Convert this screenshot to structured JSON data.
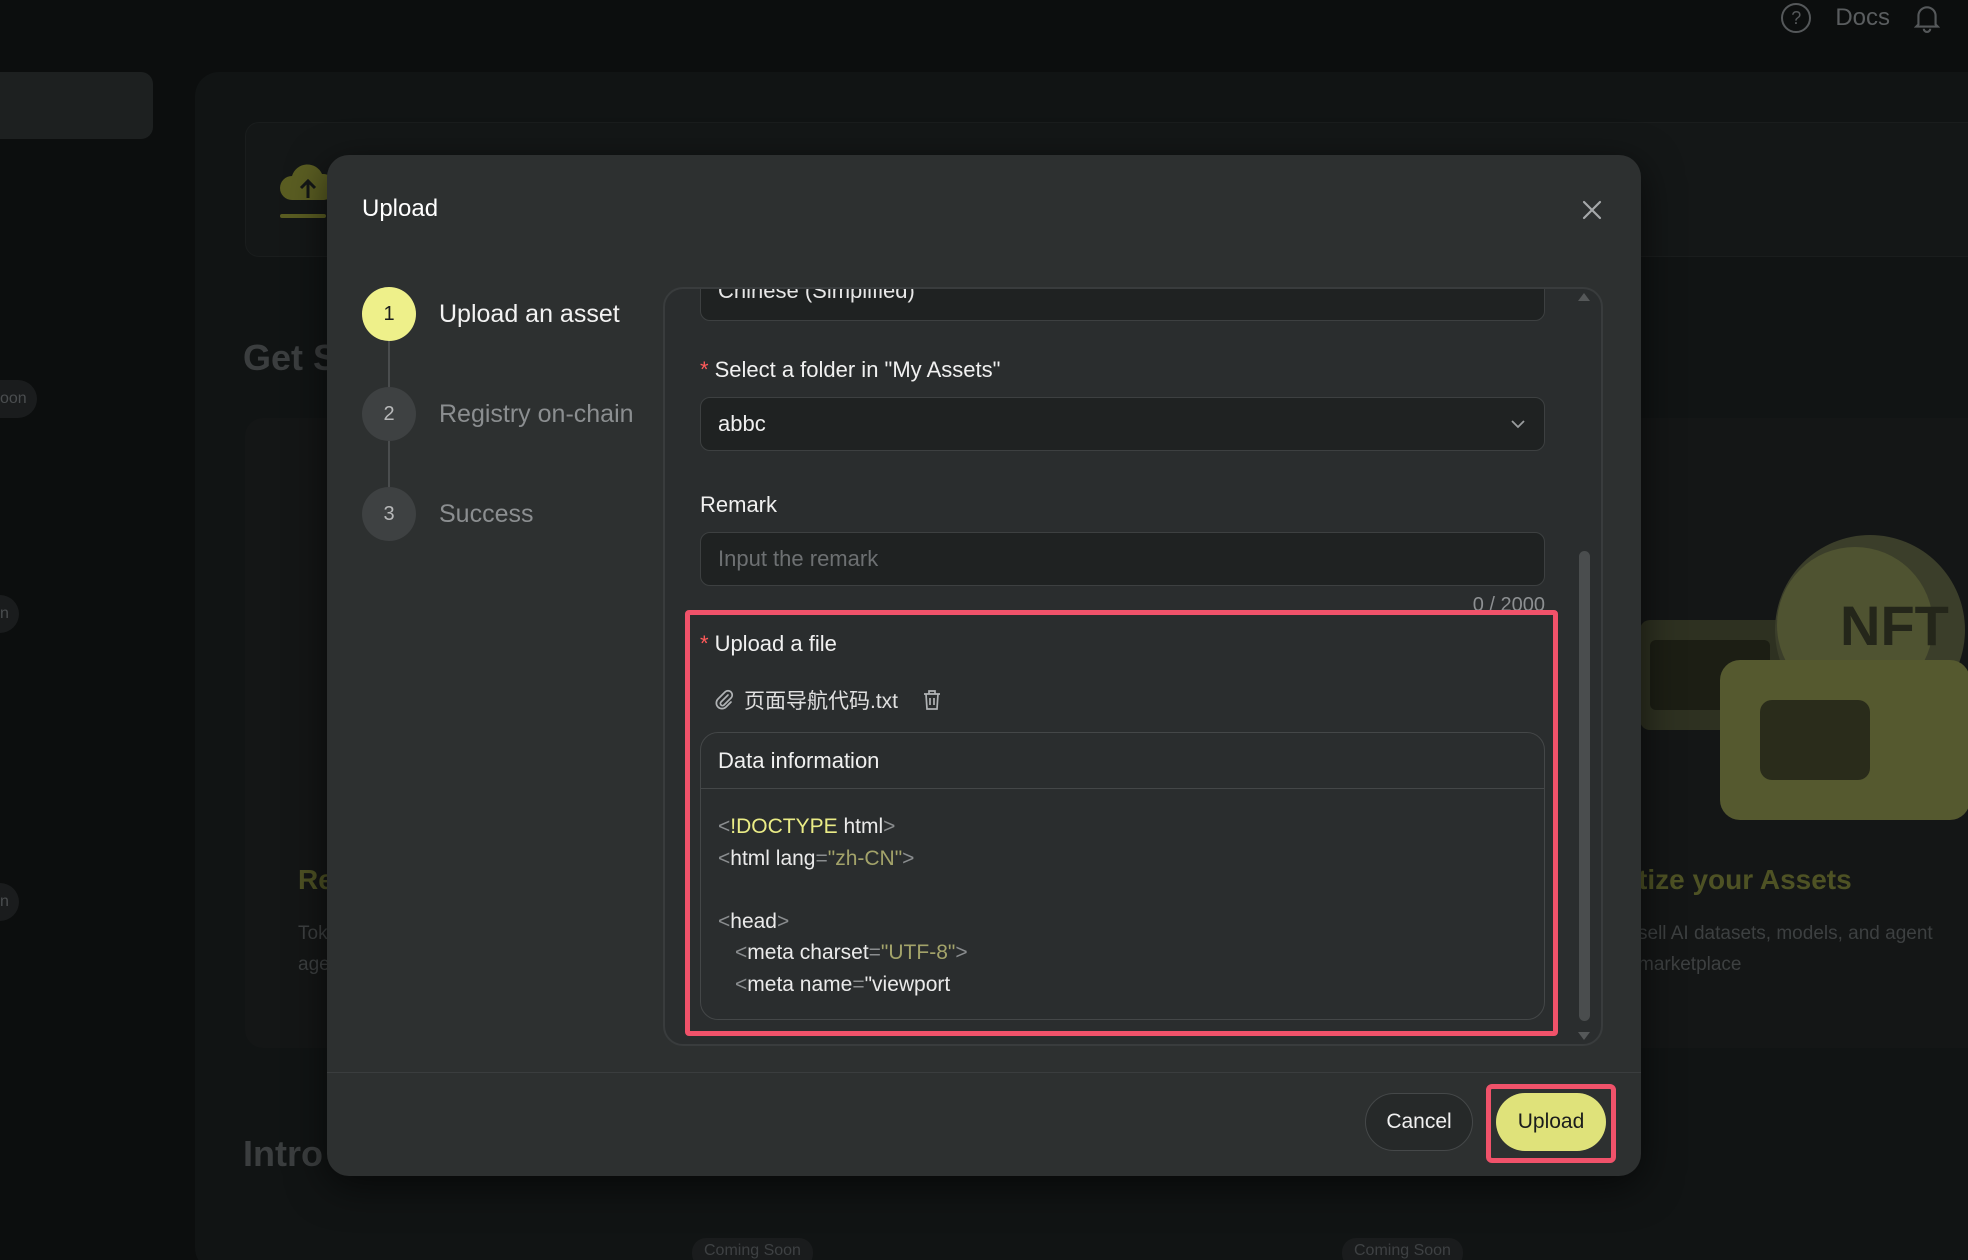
{
  "topbar": {
    "docs_label": "Docs",
    "help_icon": "question-circle-icon",
    "bell_icon": "bell-icon"
  },
  "background": {
    "heading_partial": "Get S",
    "side_tags": [
      "oon",
      "n",
      "n"
    ],
    "left_card": {
      "title_partial": "Re",
      "desc_lines": [
        "Tok",
        "age"
      ]
    },
    "right_card": {
      "title_partial": "tize your Assets",
      "desc_lines": [
        "sell AI datasets, models, and agent",
        "marketplace"
      ]
    },
    "nft_label": "NFT",
    "heading2_partial": "Intro",
    "soon_tags": [
      "Coming Soon",
      "Coming Soon"
    ]
  },
  "modal": {
    "title": "Upload",
    "close_icon": "close-icon",
    "steps": [
      {
        "number": "1",
        "label": "Upload an asset",
        "active": true
      },
      {
        "number": "2",
        "label": "Registry on-chain",
        "active": false
      },
      {
        "number": "3",
        "label": "Success",
        "active": false
      }
    ],
    "form": {
      "language_select_value": "Chinese (Simplified)",
      "folder": {
        "label": "Select a folder in \"My Assets\"",
        "required": "*",
        "value": "abbc"
      },
      "remark": {
        "label": "Remark",
        "placeholder": "Input the remark",
        "counter": "0 / 2000"
      },
      "upload_file": {
        "label": "Upload a file",
        "required": "*",
        "file_name": "页面导航代码.txt",
        "data_info_title": "Data information",
        "code": {
          "lt": "<",
          "gt": ">",
          "eq": "=",
          "line1_kw": "!DOCTYPE",
          "line1_rest": " html",
          "line2_tag": "html lang",
          "line2_val": "\"zh-CN\"",
          "line4_tag": "head",
          "line5_tag": "meta charset",
          "line5_val": "\"UTF-8\"",
          "line6_tag": "meta name",
          "line6_val": "\"viewport"
        }
      }
    },
    "buttons": {
      "cancel": "Cancel",
      "upload": "Upload"
    },
    "colors": {
      "accent": "#eef08a",
      "highlight": "#f0526a",
      "modal_bg": "#2d3030"
    }
  }
}
